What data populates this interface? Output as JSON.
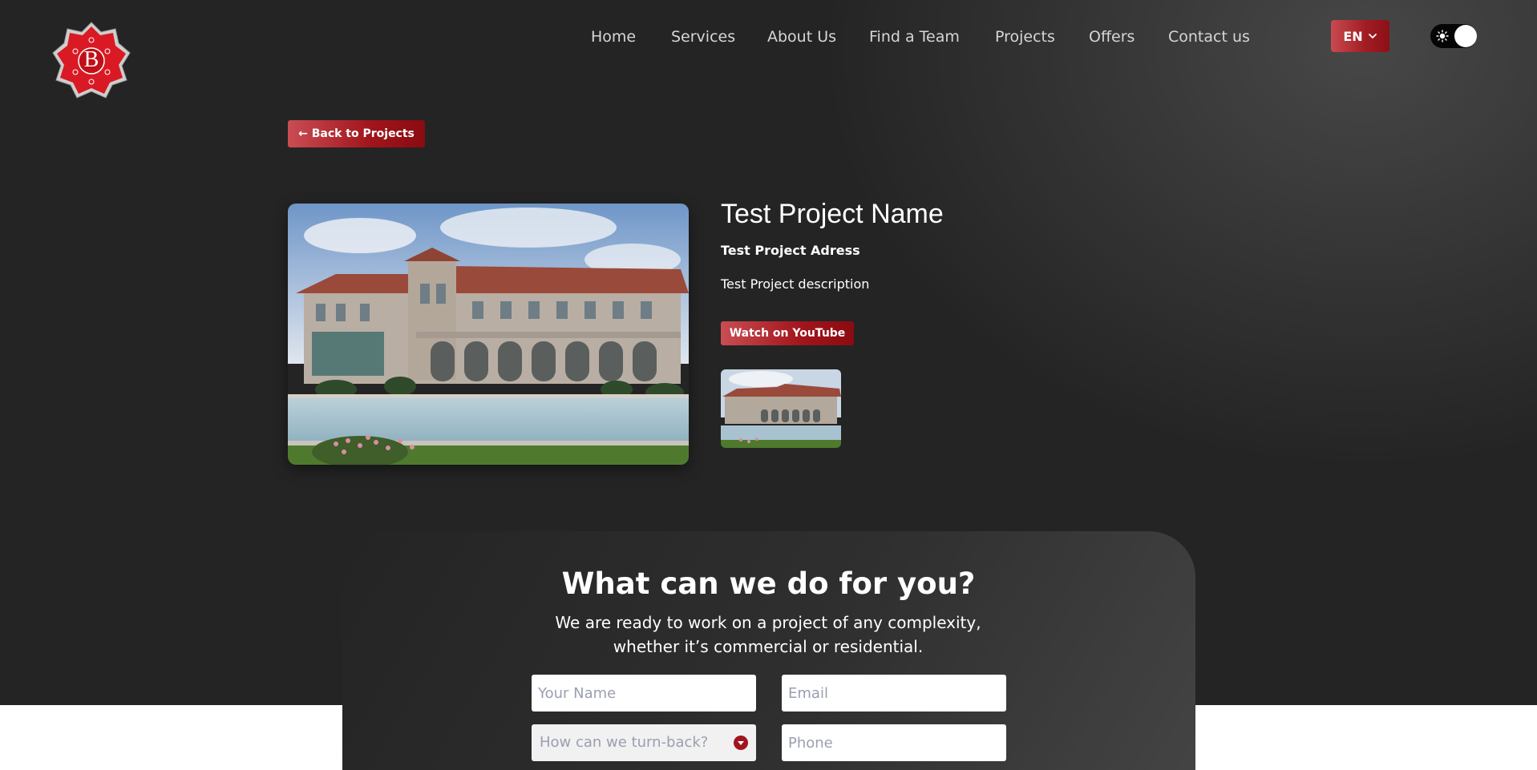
{
  "nav": {
    "items": [
      {
        "label": "Home"
      },
      {
        "label": "Services"
      },
      {
        "label": "About Us"
      },
      {
        "label": "Find a Team"
      },
      {
        "label": "Projects"
      },
      {
        "label": "Offers"
      },
      {
        "label": "Contact us"
      }
    ]
  },
  "logo": {
    "letter": "B"
  },
  "language": {
    "selected": "EN"
  },
  "theme": {
    "mode": "dark",
    "icon": "sun-icon"
  },
  "back_button": {
    "label": "← Back to Projects"
  },
  "project": {
    "title": "Test Project Name",
    "address": "Test Project Adress",
    "description": "Test Project description",
    "youtube_label": "Watch on YouTube"
  },
  "contact": {
    "title": "What can we do for you?",
    "subtitle_line1": "We are ready to work on a project of any complexity,",
    "subtitle_line2": "whether it’s commercial or residential.",
    "name_placeholder": "Your Name",
    "email_placeholder": "Email",
    "topic_placeholder": "How can we turn-back?",
    "phone_placeholder": "Phone"
  },
  "colors": {
    "accent": "#a2151c",
    "background": "#242424"
  }
}
